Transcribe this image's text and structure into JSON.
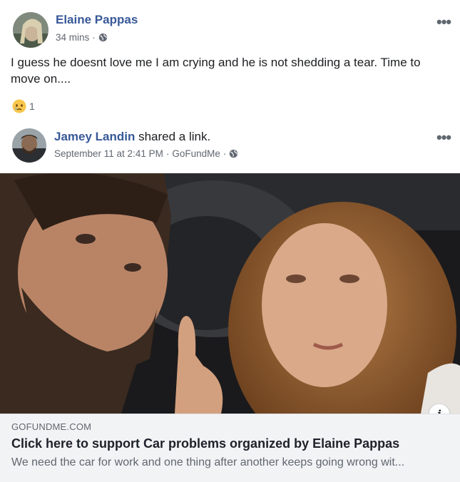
{
  "post": {
    "author": "Elaine Pappas",
    "time": "34 mins",
    "privacy_icon": "globe-icon",
    "more_icon": "more-dots-icon",
    "more_symbol": "•••",
    "text": "I guess he doesnt love me I am crying and he is not shedding a tear. Time to move on....",
    "reaction_icon": "sad-face-icon",
    "reaction_count": "1"
  },
  "shared": {
    "author": "Jamey Landin",
    "action": " shared a link.",
    "date": "September 11 at 2:41 PM",
    "separator": "·",
    "source": "GoFundMe",
    "privacy_icon": "globe-icon",
    "more_symbol": "•••"
  },
  "link": {
    "info_symbol": "i",
    "domain": "GOFUNDME.COM",
    "title": "Click here to support Car problems organized by Elaine Pappas",
    "description": "We need the car for work and one thing after another keeps going wrong wit..."
  },
  "colors": {
    "name_blue": "#385898",
    "meta_gray": "#606770",
    "caption_bg": "#f2f3f5"
  }
}
